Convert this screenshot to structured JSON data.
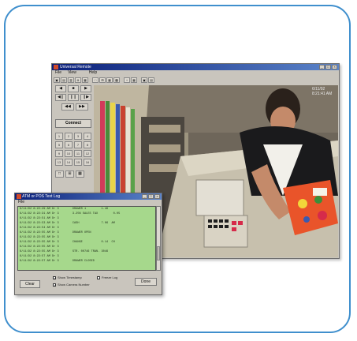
{
  "viewer": {
    "title": "Universal Remote",
    "menus": [
      "File",
      "View",
      "",
      "Help"
    ],
    "timestamp": "6/11/92 8:21:41 AM",
    "connect_label": "Connect",
    "camera_numbers": [
      "1",
      "2",
      "3",
      "4",
      "5",
      "6",
      "7",
      "8",
      "9",
      "10",
      "11",
      "12",
      "13",
      "14",
      "15",
      "16"
    ]
  },
  "log": {
    "title": "ATM or POS Text Log",
    "menu": "File",
    "rows": [
      "6/11/92 8:22:29 AM Dr 3        DRAWER 1         1.46",
      "6/11/92 8:22:31 AM Dr 3        3.25% SALES TAX         0.05",
      "6/11/92 8:22:51 AM Dr 3",
      "6/11/92 8:22:53 AM Dr 3        CASH             7.06  AM",
      "6/11/92 8:22:54 AM Dr 3",
      "6/11/92 8:22:55 AM Dr 3        DRAWER OPEN",
      "6/11/92 8:22:55 AM Dr 3",
      "6/11/92 8:22:55 AM Dr 3        CHANGE           0.14  CH",
      "6/11/92 8:22:55 AM Dr 3",
      "6/11/92 8:22:55 AM Dr 3        STR. 00746 TRAN. 3046",
      "6/11/92 8:22:57 AM Dr 3",
      "6/11/92 8:22:57 AM Dr 3        DRAWER CLOSED"
    ],
    "show_timestamp": "Show Timestamp",
    "freeze_log": "Freeze Log",
    "show_camera_number": "Show Camera Number",
    "clear_label": "Clear",
    "done_label": "Done"
  }
}
